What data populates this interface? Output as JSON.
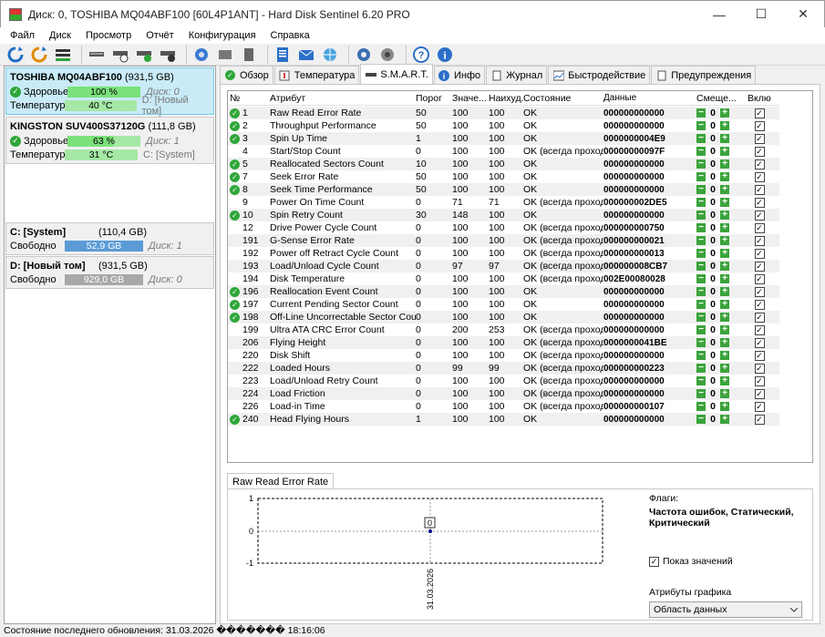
{
  "window": {
    "title": "Диск: 0, TOSHIBA MQ04ABF100 [60L4P1ANT]  -  Hard Disk Sentinel 6.20 PRO",
    "minimize": "—",
    "maximize": "☐",
    "close": "✕"
  },
  "menu": [
    "Файл",
    "Диск",
    "Просмотр",
    "Отчёт",
    "Конфигурация",
    "Справка"
  ],
  "disks": [
    {
      "name": "TOSHIBA MQ04ABF100",
      "size": "(931,5 GB)",
      "health_label": "Здоровье:",
      "health": "100 %",
      "health_value": 100,
      "disk_index": "Диск: 0",
      "temp_label": "Температура:",
      "temp": "40 °C",
      "volume": "D: [Новый том]"
    },
    {
      "name": "KINGSTON SUV400S37120G",
      "size": "(111,8 GB)",
      "health_label": "Здоровье:",
      "health": "63 %",
      "health_value": 63,
      "disk_index": "Диск: 1",
      "temp_label": "Температура:",
      "temp": "31 °C",
      "volume": "C: [System]"
    }
  ],
  "volumes": [
    {
      "name": "C: [System]",
      "size": "(110,4 GB)",
      "free_label": "Свободно",
      "free": "52,9 GB",
      "disk": "Диск: 1"
    },
    {
      "name": "D: [Новый том]",
      "size": "(931,5 GB)",
      "free_label": "Свободно",
      "free": "929,0 GB",
      "disk": "Диск: 0"
    }
  ],
  "tabs": [
    "Обзор",
    "Температура",
    "S.M.A.R.T.",
    "Инфо",
    "Журнал",
    "Быстродействие",
    "Предупреждения"
  ],
  "table": {
    "headers": [
      "№",
      "Атрибут",
      "Порог",
      "Значе...",
      "Наихуд...",
      "Состояние",
      "Данные",
      "Смеще...",
      "Вклю..."
    ],
    "rows": [
      {
        "ok": true,
        "n": "1",
        "attr": "Raw Read Error Rate",
        "thr": "50",
        "val": "100",
        "worst": "100",
        "state": "OK",
        "data": "000000000000"
      },
      {
        "ok": true,
        "n": "2",
        "attr": "Throughput Performance",
        "thr": "50",
        "val": "100",
        "worst": "100",
        "state": "OK",
        "data": "000000000000"
      },
      {
        "ok": true,
        "n": "3",
        "attr": "Spin Up Time",
        "thr": "1",
        "val": "100",
        "worst": "100",
        "state": "OK",
        "data": "0000000004E9"
      },
      {
        "ok": false,
        "n": "4",
        "attr": "Start/Stop Count",
        "thr": "0",
        "val": "100",
        "worst": "100",
        "state": "OK (всегда проходит)",
        "data": "00000000097F"
      },
      {
        "ok": true,
        "n": "5",
        "attr": "Reallocated Sectors Count",
        "thr": "10",
        "val": "100",
        "worst": "100",
        "state": "OK",
        "data": "000000000000"
      },
      {
        "ok": true,
        "n": "7",
        "attr": "Seek Error Rate",
        "thr": "50",
        "val": "100",
        "worst": "100",
        "state": "OK",
        "data": "000000000000"
      },
      {
        "ok": true,
        "n": "8",
        "attr": "Seek Time Performance",
        "thr": "50",
        "val": "100",
        "worst": "100",
        "state": "OK",
        "data": "000000000000"
      },
      {
        "ok": false,
        "n": "9",
        "attr": "Power On Time Count",
        "thr": "0",
        "val": "71",
        "worst": "71",
        "state": "OK (всегда проходит)",
        "data": "000000002DE5"
      },
      {
        "ok": true,
        "n": "10",
        "attr": "Spin Retry Count",
        "thr": "30",
        "val": "148",
        "worst": "100",
        "state": "OK",
        "data": "000000000000"
      },
      {
        "ok": false,
        "n": "12",
        "attr": "Drive Power Cycle Count",
        "thr": "0",
        "val": "100",
        "worst": "100",
        "state": "OK (всегда проходит)",
        "data": "000000000750"
      },
      {
        "ok": false,
        "n": "191",
        "attr": "G-Sense Error Rate",
        "thr": "0",
        "val": "100",
        "worst": "100",
        "state": "OK (всегда проходит)",
        "data": "000000000021"
      },
      {
        "ok": false,
        "n": "192",
        "attr": "Power off Retract Cycle Count",
        "thr": "0",
        "val": "100",
        "worst": "100",
        "state": "OK (всегда проходит)",
        "data": "000000000013"
      },
      {
        "ok": false,
        "n": "193",
        "attr": "Load/Unload Cycle Count",
        "thr": "0",
        "val": "97",
        "worst": "97",
        "state": "OK (всегда проходит)",
        "data": "000000008CB7"
      },
      {
        "ok": false,
        "n": "194",
        "attr": "Disk Temperature",
        "thr": "0",
        "val": "100",
        "worst": "100",
        "state": "OK (всегда проходит)",
        "data": "002E00080028"
      },
      {
        "ok": true,
        "n": "196",
        "attr": "Reallocation Event Count",
        "thr": "0",
        "val": "100",
        "worst": "100",
        "state": "OK",
        "data": "000000000000"
      },
      {
        "ok": true,
        "n": "197",
        "attr": "Current Pending Sector Count",
        "thr": "0",
        "val": "100",
        "worst": "100",
        "state": "OK",
        "data": "000000000000"
      },
      {
        "ok": true,
        "n": "198",
        "attr": "Off-Line Uncorrectable Sector Count",
        "thr": "0",
        "val": "100",
        "worst": "100",
        "state": "OK",
        "data": "000000000000"
      },
      {
        "ok": false,
        "n": "199",
        "attr": "Ultra ATA CRC Error Count",
        "thr": "0",
        "val": "200",
        "worst": "253",
        "state": "OK (всегда проходит)",
        "data": "000000000000"
      },
      {
        "ok": false,
        "n": "206",
        "attr": "Flying Height",
        "thr": "0",
        "val": "100",
        "worst": "100",
        "state": "OK (всегда проходит)",
        "data": "0000000041BE"
      },
      {
        "ok": false,
        "n": "220",
        "attr": "Disk Shift",
        "thr": "0",
        "val": "100",
        "worst": "100",
        "state": "OK (всегда проходит)",
        "data": "000000000000"
      },
      {
        "ok": false,
        "n": "222",
        "attr": "Loaded Hours",
        "thr": "0",
        "val": "99",
        "worst": "99",
        "state": "OK (всегда проходит)",
        "data": "000000000223"
      },
      {
        "ok": false,
        "n": "223",
        "attr": "Load/Unload Retry Count",
        "thr": "0",
        "val": "100",
        "worst": "100",
        "state": "OK (всегда проходит)",
        "data": "000000000000"
      },
      {
        "ok": false,
        "n": "224",
        "attr": "Load Friction",
        "thr": "0",
        "val": "100",
        "worst": "100",
        "state": "OK (всегда проходит)",
        "data": "000000000000"
      },
      {
        "ok": false,
        "n": "226",
        "attr": "Load-in Time",
        "thr": "0",
        "val": "100",
        "worst": "100",
        "state": "OK (всегда проходит)",
        "data": "000000000107"
      },
      {
        "ok": true,
        "n": "240",
        "attr": "Head Flying Hours",
        "thr": "1",
        "val": "100",
        "worst": "100",
        "state": "OK",
        "data": "000000000000"
      }
    ],
    "offset_value": "0",
    "minus": "−",
    "plus": "+",
    "ok_mark": "✓",
    "checkmark": "✓"
  },
  "graph": {
    "tab_label": "Raw Read Error Rate",
    "y_ticks": [
      "1",
      "0",
      "-1"
    ],
    "point_label": "0",
    "x_label": "31.03.2026",
    "flags_label": "Флаги:",
    "flags_value": "Частота ошибок, Статический, Критический",
    "show_values_label": "Показ значений",
    "show_values_checked": true,
    "attr_label": "Атрибуты графика",
    "attr_select": "Область данных",
    "chart_data": {
      "type": "line",
      "x": [
        "31.03.2026"
      ],
      "values": [
        0
      ],
      "ylim": [
        -1,
        1
      ]
    }
  },
  "status": "Состояние последнего обновления: 31.03.2026 ������� 18:16:06",
  "colors": {
    "ok_green": "#2fa63a",
    "selected_bg": "#c9ebf7",
    "bar_blue": "#5b9bd5"
  }
}
